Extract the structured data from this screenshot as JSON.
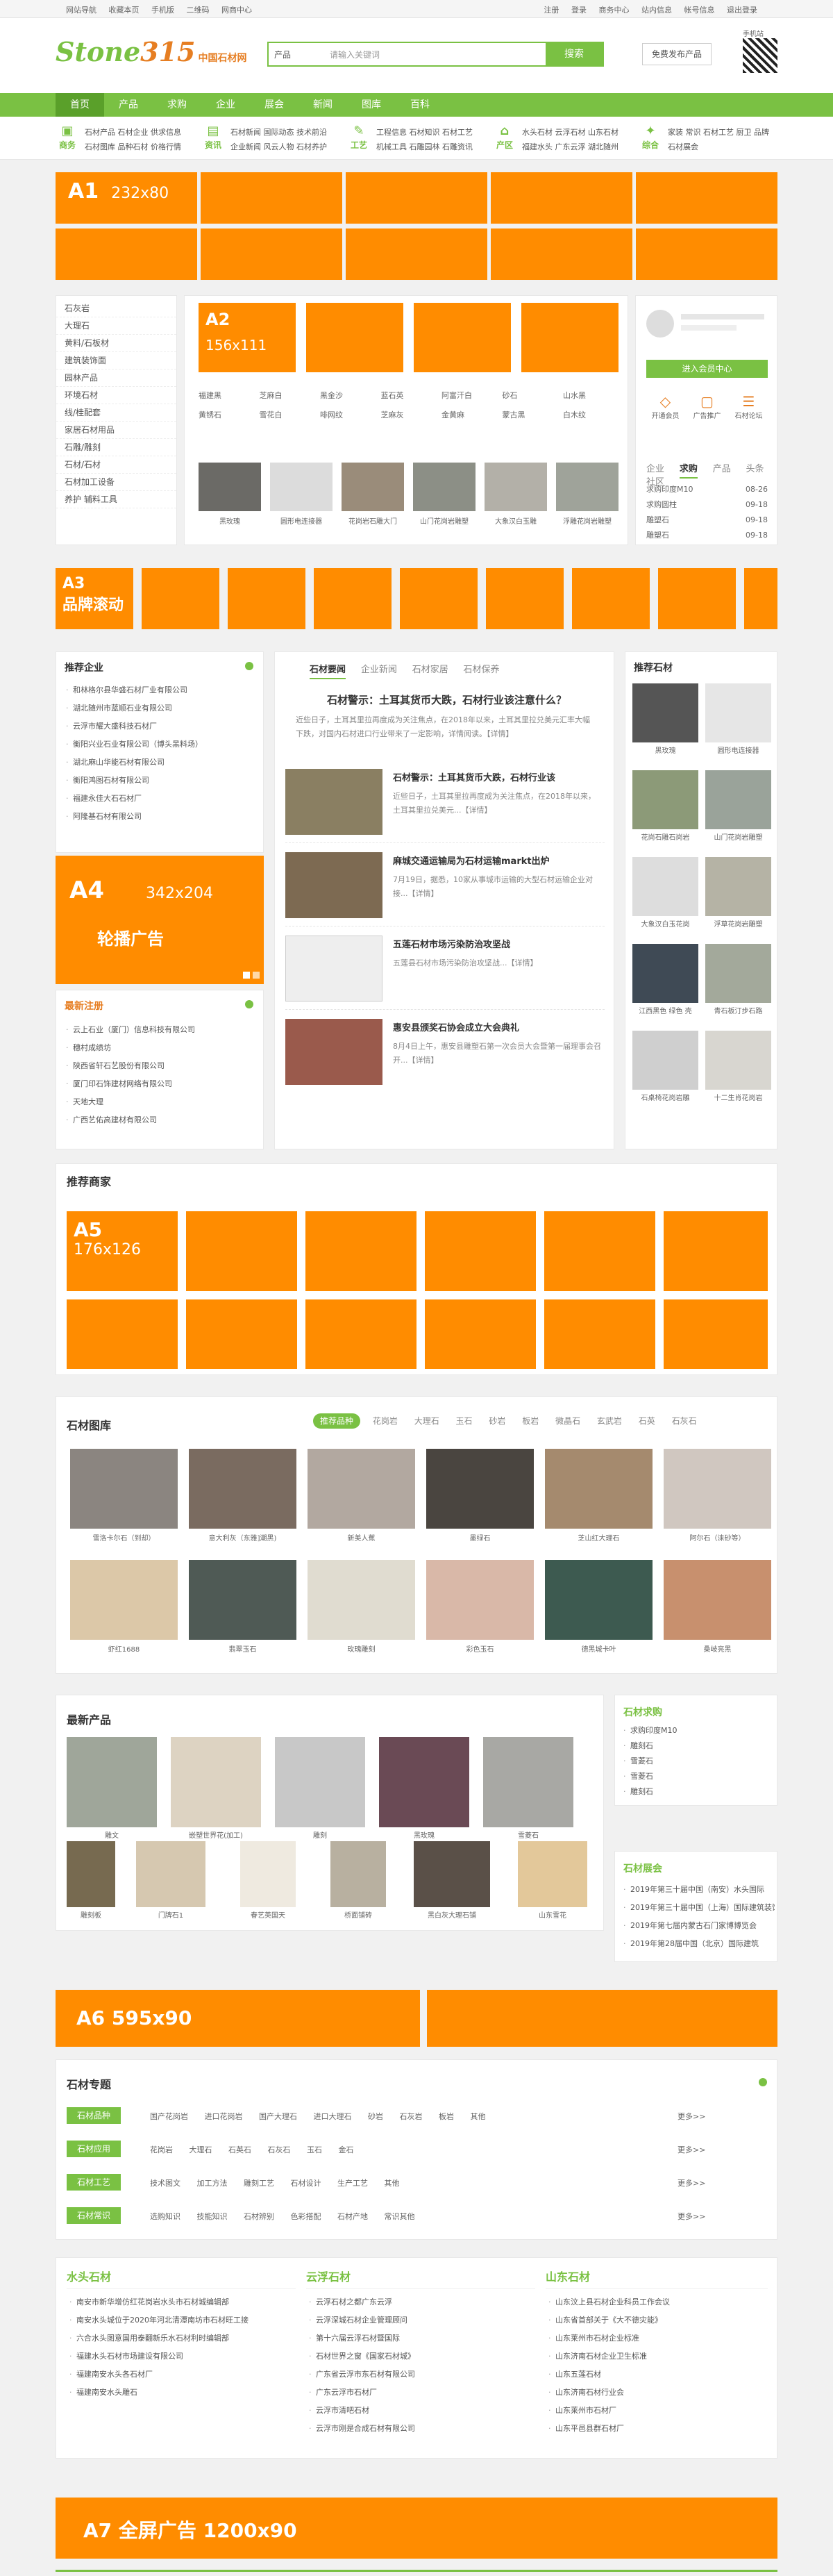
{
  "topbar": {
    "left": [
      "网站导航",
      "收藏本页",
      "手机版",
      "二维码",
      "网商中心"
    ],
    "right": [
      "注册",
      "登录",
      "商务中心",
      "站内信息",
      "帐号信息",
      "退出登录"
    ]
  },
  "header": {
    "logo": "Stone",
    "logo_sub": "中国石材网",
    "logo_num": "315",
    "search_cat": "产品",
    "search_placeholder": "请输入关键词",
    "search_btn": "搜索",
    "publish_btn": "免费发布产品",
    "qr_label": "手机站"
  },
  "nav": [
    "首页",
    "产品",
    "求购",
    "企业",
    "展会",
    "新闻",
    "图库",
    "百科"
  ],
  "catrow": [
    {
      "icon": "商务",
      "links": "石材产品 石材企业 供求信息 石材图库 品种石材 价格行情"
    },
    {
      "icon": "资讯",
      "links": "石材新闻 国际动态 技术前沿 企业新闻 风云人物 石材养护"
    },
    {
      "icon": "工艺",
      "links": "工程信息 石材知识 石材工艺 机械工具 石雕园林 石雕资讯"
    },
    {
      "icon": "产区",
      "links": "水头石材 云浮石材 山东石材 福建水头 广东云浮 湖北随州"
    },
    {
      "icon": "综合",
      "links": "家装 常识 石材工艺 厨卫 品牌 石材展会"
    }
  ],
  "ads": {
    "a1": "A1",
    "a1_size": "232x80",
    "a2": "A2",
    "a2_size": "156x111",
    "a3": "A3",
    "a3_name": "品牌滚动",
    "a4": "A4",
    "a4_size": "342x204",
    "a4_name": "轮播广告",
    "a5": "A5",
    "a5_size": "176x126",
    "a6": "A6",
    "a6_size": "595x90",
    "a7": "A7 全屏广告",
    "a7_size": "1200x90"
  },
  "sidecats": [
    "石灰岩",
    "大理石",
    "黄料/石板材",
    "建筑装饰面",
    "园林产品",
    "环境石材",
    "线/桂配套",
    "家居石材用品",
    "石雕/雕刻",
    "石材/石材",
    "石材加工设备",
    "养护 辅料工具"
  ],
  "mid_thumbs": [
    "福建黑",
    "芝麻白",
    "黑金沙",
    "蓝石英",
    "阿富汗白",
    "砂石",
    "山水黑",
    "黄锈石",
    "雪花白",
    "啡网纹",
    "芝麻灰",
    "金黄麻",
    "蒙古黑",
    "白木纹"
  ],
  "mid_products": [
    "黑玫瑰",
    "圆形电连接器",
    "花岗岩石雕大门",
    "山门花岗岩雕塑",
    "大象汉白玉雕",
    "浮雕花岗岩雕塑"
  ],
  "login": {
    "btn": "进入会员中心",
    "icons": [
      "开通会员",
      "广告推广",
      "石材论坛"
    ],
    "tabs": [
      "企业",
      "求购",
      "产品",
      "头条",
      "社区"
    ],
    "rows": [
      [
        "求购印度M10",
        "08-26"
      ],
      [
        "求购圆柱",
        "09-18"
      ],
      [
        "雕塑石",
        "09-18"
      ],
      [
        "雕塑石",
        "09-18"
      ]
    ]
  },
  "recommend_ent": {
    "title": "推荐企业",
    "items": [
      "和林格尔县华盛石材厂业有限公司",
      "湖北随州市蓝顺石业有限公司",
      "云浮市耀大盛科技石材厂",
      "衡阳兴业石业有限公司（博头黑料场）",
      "湖北麻山华能石材有限公司",
      "衡阳鸿图石材有限公司",
      "福建永佳大石石材厂",
      "阿隆基石材有限公司"
    ]
  },
  "latest_reg": {
    "title": "最新注册",
    "items": [
      "云上石业（厦门）信息科技有限公司",
      "穗村成绩坊",
      "陕西省轩石艺股份有限公司",
      "厦门印石饰建材网络有限公司",
      "天地大理",
      "广西艺佑高建材有限公司"
    ]
  },
  "news": {
    "tabs": [
      "石材要闻",
      "企业新闻",
      "石材家居",
      "石材保养"
    ],
    "headline": "石材警示：土耳其货币大跌，石材行业该注意什么？",
    "headline_desc": "近些日子，土耳其里拉再度成为关注焦点，在2018年以来，土耳其里拉兑美元汇率大幅下跌，对国内石材进口行业带来了一定影响，详情阅读。【详情】",
    "items": [
      {
        "title": "石材警示：土耳其货币大跌，石材行业该",
        "desc": "近些日子，土耳其里拉再度成为关注焦点，在2018年以来，土耳其里拉兑美元...【详情】"
      },
      {
        "title": "麻城交通运输局为石材运输markt出炉",
        "desc": "7月19日，据悉，10家从事城市运输的大型石材运输企业对接...【详情】"
      },
      {
        "title": "五莲石材市场污染防治攻坚战",
        "desc": "五莲县石材市场污染防治攻坚战...【详情】"
      },
      {
        "title": "惠安县颁奖石协会成立大会典礼",
        "desc": "8月4日上午，惠安县雕塑石第一次会员大会暨第一届理事会召开...【详情】"
      }
    ]
  },
  "rec_stone": {
    "title": "推荐石材",
    "items": [
      "黑玫瑰",
      "圆形电连接器",
      "花岗石雕石岗岩",
      "山门花岗岩雕塑",
      "大象汉白玉花岗",
      "浮草花岗岩雕塑",
      "江西黑色 绿色 壳",
      "青石板汀步石路",
      "石桌椅花岗岩雕",
      "十二生肖花岗岩"
    ]
  },
  "merchants": {
    "title": "推荐商家"
  },
  "gallery": {
    "title": "石材图库",
    "tabs": [
      "推荐品种",
      "花岗岩",
      "大理石",
      "玉石",
      "砂岩",
      "板岩",
      "微晶石",
      "玄武岩",
      "石英",
      "石灰石"
    ],
    "items": [
      "雪洛卡尔石（到却）",
      "意大利灰（东雅]潮黑)",
      "新美人蕉",
      "墨绿石",
      "芝山红大理石",
      "阿尔石（涞砂等）",
      "虾红1688",
      "翡翠玉石",
      "玫瑰雕刻",
      "彩色玉石",
      "德黑城卡叶",
      "桑岐亮黑"
    ]
  },
  "latest_prod": {
    "title": "最新产品",
    "items": [
      "雕文",
      "嵌塑世界花(加工)",
      "雕刻",
      "黑玫瑰",
      "雪菱石",
      "雕刻板",
      "门牌石1",
      "春艺英国天",
      "桥面铺砖",
      "黑白灰大理石铺",
      "山东雪花"
    ]
  },
  "purchase": {
    "title": "石材求购",
    "items": [
      "求购印度M10",
      "雕刻石",
      "雪菱石",
      "雪菱石",
      "雕刻石"
    ]
  },
  "expo": {
    "title": "石材展会",
    "items": [
      "2019年第三十届中国（南安）水头国际",
      "2019年第三十届中国（上海）国际建筑装饰",
      "2019年第七届内蒙古石门家博博览会",
      "2019年第28届中国（北京）国际建筑"
    ]
  },
  "topic": {
    "title": "石材专题",
    "more": "更多>>",
    "rows": [
      {
        "tag": "石材品种",
        "items": [
          "国产花岗岩",
          "进口花岗岩",
          "国产大理石",
          "进口大理石",
          "砂岩",
          "石灰岩",
          "板岩",
          "其他"
        ]
      },
      {
        "tag": "石材应用",
        "items": [
          "花岗岩",
          "大理石",
          "石英石",
          "石灰石",
          "玉石",
          "金石"
        ]
      },
      {
        "tag": "石材工艺",
        "items": [
          "技术图文",
          "加工方法",
          "雕刻工艺",
          "石材设计",
          "生产工艺",
          "其他"
        ]
      },
      {
        "tag": "石材常识",
        "items": [
          "选购知识",
          "技能知识",
          "石材辨别",
          "色彩搭配",
          "石材产地",
          "常识其他"
        ]
      }
    ]
  },
  "areas": [
    {
      "title": "水头石材",
      "items": [
        "南安市新华增仿红花岗岩水头市石材城编辑部",
        "南安水头城位于2020年河北清潭南坊市石材旺工接",
        "六合水头图意国用泰翻新乐水石材利时编辑部",
        "福建水头石材市场建设有限公司",
        "福建南安水头各石材厂",
        "福建南安水头雕石"
      ],
      "numbered": false
    },
    {
      "title": "云浮石材",
      "items": [
        "云浮石材之都广东云浮",
        "云浮深城石材企业管理顾问",
        "第十六届云浮石材暨国际",
        "石材世界之窗《国家石材城》",
        "广东省云浮市东石材有限公司",
        "广东云浮市石材厂",
        "云浮市清吧石材",
        "云浮市刚是合成石材有限公司"
      ],
      "numbered": true
    },
    {
      "title": "山东石材",
      "items": [
        "山东汶上县石材企业科员工作会议",
        "山东省首部关于《大不德灾能》",
        "山东莱州市石材企业标准",
        "山东济南石材企业卫生标准",
        "山东五莲石材",
        "山东济南石材行业会",
        "山东莱州市石材厂",
        "山东平邑县群石材厂"
      ],
      "numbered": false
    }
  ],
  "colors": {
    "green": "#7ac143",
    "orange": "#ff8c00"
  }
}
